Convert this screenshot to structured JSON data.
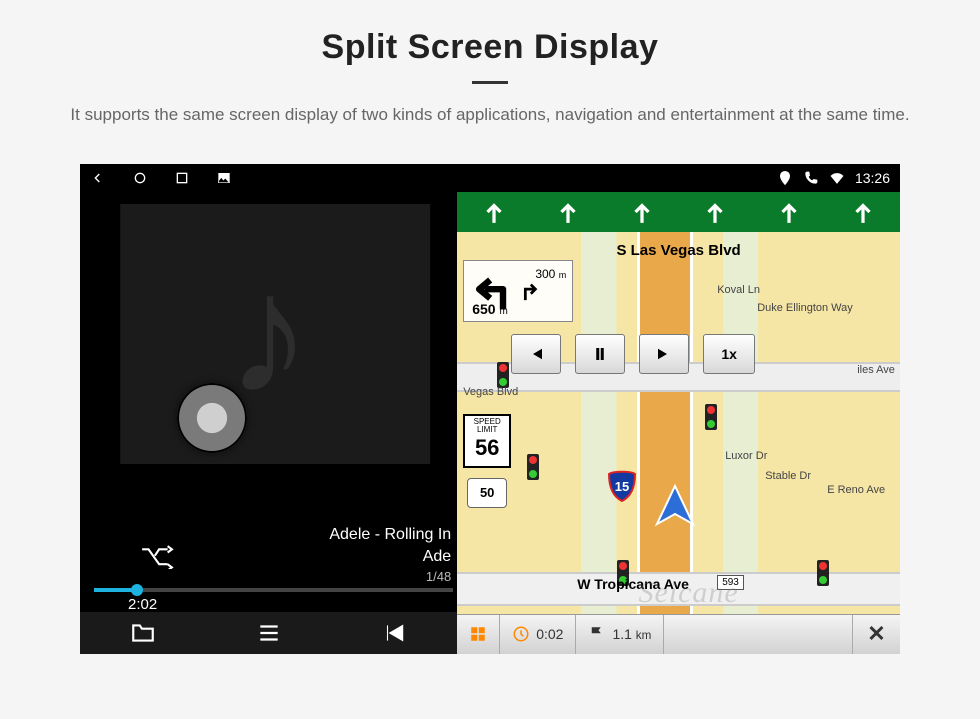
{
  "header": {
    "title": "Split Screen Display",
    "subtitle": "It supports the same screen display of two kinds of applications, navigation and entertainment at the same time."
  },
  "statusbar": {
    "time": "13:26"
  },
  "music": {
    "track_title": "Adele - Rolling In",
    "artist": "Ade",
    "track_index": "1/48",
    "elapsed": "2:02"
  },
  "nav": {
    "street_top": "S Las Vegas Blvd",
    "street_bottom": "W Tropicana Ave",
    "street_bottom_badge": "593",
    "turn_dist_main": "650",
    "turn_dist_main_unit": "m",
    "turn_dist_next": "300",
    "turn_dist_next_unit": "m",
    "speed_limit_label": "SPEED LIMIT",
    "speed_limit": "56",
    "route_shield": "50",
    "interstate": "15",
    "playback_speed": "1x",
    "labels": {
      "vegas_blvd": "Vegas Blvd",
      "koval": "Koval Ln",
      "duke": "Duke Ellington Way",
      "luxor": "Luxor Dr",
      "stable": "Stable Dr",
      "reno": "E Reno Ave",
      "iles": "iles Ave"
    },
    "bottombar": {
      "time": "0:02",
      "dist": "1.1",
      "dist_unit": "km"
    }
  },
  "watermark": "Seicane"
}
